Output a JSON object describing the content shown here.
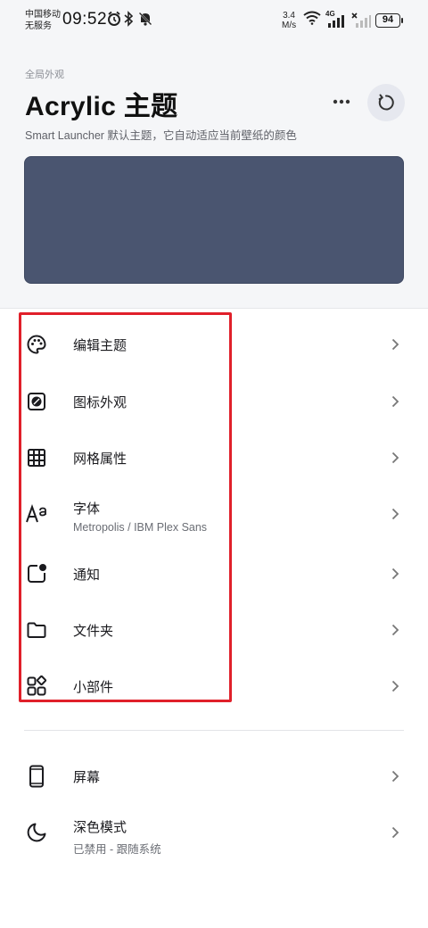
{
  "status_bar": {
    "carrier_line1": "中国移动",
    "carrier_line2": "无服务",
    "time": "09:52",
    "speed_value": "3.4",
    "speed_unit": "M/s",
    "network": "4G",
    "battery": "94"
  },
  "header": {
    "overline": "全局外观",
    "title": "Acrylic 主题",
    "subtitle": "Smart Launcher 默认主题，它自动适应当前壁纸的颜色",
    "preview_color": "#4a5570"
  },
  "theme_items": [
    {
      "label": "编辑主题",
      "icon": "palette-icon"
    },
    {
      "label": "图标外观",
      "icon": "icon-shape-icon"
    },
    {
      "label": "网格属性",
      "icon": "grid-icon"
    },
    {
      "label": "字体",
      "sub": "Metropolis / IBM Plex Sans",
      "icon": "font-icon"
    },
    {
      "label": "通知",
      "icon": "notification-dot-icon"
    },
    {
      "label": "文件夹",
      "icon": "folder-icon"
    },
    {
      "label": "小部件",
      "icon": "widgets-icon"
    }
  ],
  "other_items": [
    {
      "label": "屏幕",
      "icon": "phone-screen-icon"
    },
    {
      "label": "深色模式",
      "sub": "已禁用 - 跟随系统",
      "icon": "moon-icon"
    }
  ],
  "colors": {
    "highlight": "#e0202a",
    "accent_bg": "#e6e8ef"
  }
}
